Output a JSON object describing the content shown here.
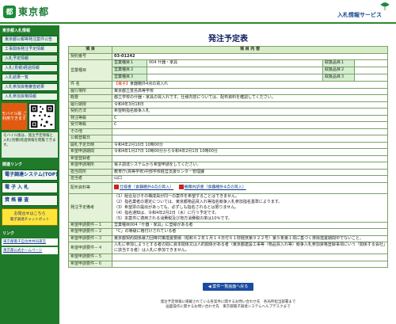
{
  "header": {
    "logo_text": "東京都",
    "logo_mark": "都",
    "service_name": "入札情報サービス"
  },
  "sidebar": {
    "section1": "東京都入札情報",
    "buttons1": [
      "東京都公報等発注案件公告",
      "工事関係発注予定情報",
      "入札予定情報",
      "入札(見積)経過情報",
      "入札結果一覧",
      "入札参加資格審査結果",
      "入札参加資格情報"
    ],
    "mobile_badge": "モバイル版 ご利用できます",
    "side_note": "モバイル版は、発注予定情報と入札(見積)経過情報を閲覧できます。",
    "section2": "関連リンク",
    "big_buttons": [
      "電子調達システム(TOP)",
      "電 子 入 札",
      "資 格 審 査"
    ],
    "yellow_btn_1": "お問合せはこちら",
    "yellow_btn_2": "電子調達チャットボット",
    "section3": "リンク",
    "links": [
      "東京都電子自治体共同運営",
      "東京都公式ホームページ"
    ]
  },
  "main": {
    "page_title": "発注予定表",
    "col_item": "項 目",
    "col_content": "項 目 内 容",
    "rows": {
      "contract_no_lbl": "契約番号",
      "contract_no": "03-01242",
      "biz_type_lbl": "営業種目",
      "biz1_lbl": "営業種目１",
      "biz1_val": "004 什器・家具",
      "tori1": "取扱品目１",
      "biz2_lbl": "営業種目２",
      "tori2": "取扱品目２",
      "biz3_lbl": "営業種目３",
      "tori3": "取扱品目３",
      "name_lbl": "件 名",
      "name_tag": "【電子】",
      "name_val": "食器棚外4点の買入れ",
      "place_lbl": "履行場所",
      "place_val": "東京都立豊島高等学校",
      "summary_lbl": "概要",
      "summary_val": "都立学校の什器・家具の買入れです。仕様内容については、配布資料を確認してください。",
      "deadline_lbl": "履行期限",
      "deadline_val": "令和4年3月18日",
      "method_lbl": "契約方法",
      "method_val": "希望制指名競争入札",
      "scale_lbl": "発注等級",
      "scale_val": "C",
      "recv_lbl": "受付等級",
      "recv_val": "C",
      "other_lbl": "その他",
      "pubdate_lbl": "公報登載日",
      "opendate_lbl": "開札予定日時",
      "opendate_val": "令和4年2月10日 10時00分",
      "apply_lbl": "希望申請期間",
      "apply_val": "令和4年1月27日 10時00分から令和4年2月1日 10時00分",
      "reg_lbl": "希望登録者",
      "reqmethod_lbl": "希望申請場所",
      "reqmethod_val": "電子調達システムから希望申請をしてください。",
      "office_lbl": "担当局所",
      "office_val": "教育庁(高等学校)中部学校経営支援センター管理課",
      "person_lbl": "担当者",
      "person_val": "山口",
      "docs_lbl": "配布資料等",
      "doc1": "仕様書（食器棚外4点の買入）",
      "doc2": "機種内訳書（食器棚外4点の買入）",
      "notes_lbl": "発注予定備考",
      "notes": [
        "（1）組合及びその構成員が同一の案件を希望することはできません。",
        "（2）指名業者の選定については、東京都物品買入れ等指名競争入札参加指名基準によります。",
        "（3）希望票の提出があっても、必ずしも指名されるとは限りません。",
        "（4）指名通知は、令和4年2月2日（水）に行う予定です。",
        "（5）本案件に適用される消費税及び地方消費税の率は10％です。"
      ],
      "cond1_lbl": "希望申請要件－１",
      "cond1_val": "営業種目004「什器・家具」に登録がある者",
      "cond2_lbl": "希望申請要件－２",
      "cond2_val": "「C」の等級に格付けされている者",
      "cond3_lbl": "希望申請要件－３",
      "cond3_val": "東京都契約関係暴力団等対策措置要綱（昭和６２年１月１４日付６１財経庶第９２２号）第５条第１項に基づく排除措置期間中でないこと。",
      "cond4_lbl": "希望申請要件－４",
      "cond4_val": "入札に参加しようとする者の間に資本関係又は人的関係がある者（東京都建設工事等（物品買入れ等）競争入札参加資格登録事項にいう「関係する会社」に該当する者）は入札に参加できません。",
      "cond5_lbl": "希望申請要件－５",
      "cond6_lbl": "希望申請要件－６"
    },
    "back_button": "案件一覧画面へ戻る",
    "footer_line1": "発注予定情報に掲載されている各案件に関するお問い合わせ先　各局所担当部署まで",
    "footer_line2": "画面操作に関するお問い合わせ先　東京都電子調達システムヘルプデスクまで"
  },
  "colors": {
    "sidebar_green": "#1f7a2a",
    "label_bg": "#e4f2d8",
    "accent_blue": "#1a4ca0"
  }
}
